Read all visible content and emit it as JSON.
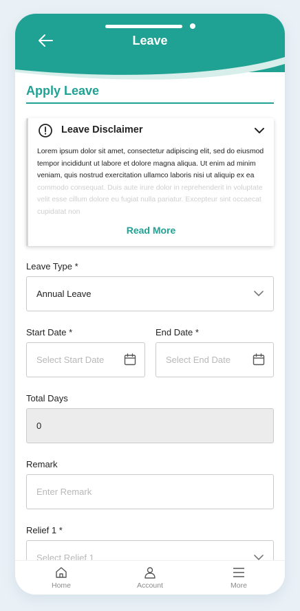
{
  "header": {
    "title": "Leave",
    "back_icon": "arrow-left-icon",
    "color": "#1fa294"
  },
  "section": {
    "title": "Apply Leave"
  },
  "disclaimer": {
    "title": "Leave Disclaimer",
    "text_visible": "Lorem ipsum dolor sit amet, consectetur adipiscing elit, sed do eiusmod tempor incididunt ut labore et dolore magna aliqua. Ut enim ad minim veniam, quis nostrud exercitation ullamco laboris nisi ut aliquip ex ea",
    "text_faded": " commodo consequat. Duis aute irure dolor in reprehenderit in voluptate velit esse cillum dolore eu fugiat nulla pariatur. Excepteur sint occaecat cupidatat non",
    "read_more": "Read More"
  },
  "form": {
    "leave_type": {
      "label": "Leave Type *",
      "value": "Annual Leave"
    },
    "start_date": {
      "label": "Start Date *",
      "placeholder": "Select Start Date"
    },
    "end_date": {
      "label": "End Date *",
      "placeholder": "Select End Date"
    },
    "total_days": {
      "label": "Total Days",
      "value": "0"
    },
    "remark": {
      "label": "Remark",
      "placeholder": "Enter Remark"
    },
    "relief1": {
      "label": "Relief 1 *",
      "placeholder": "Select Relief 1"
    }
  },
  "nav": [
    {
      "label": "Home",
      "icon": "home-icon"
    },
    {
      "label": "Account",
      "icon": "account-icon"
    },
    {
      "label": "More",
      "icon": "menu-icon"
    }
  ]
}
